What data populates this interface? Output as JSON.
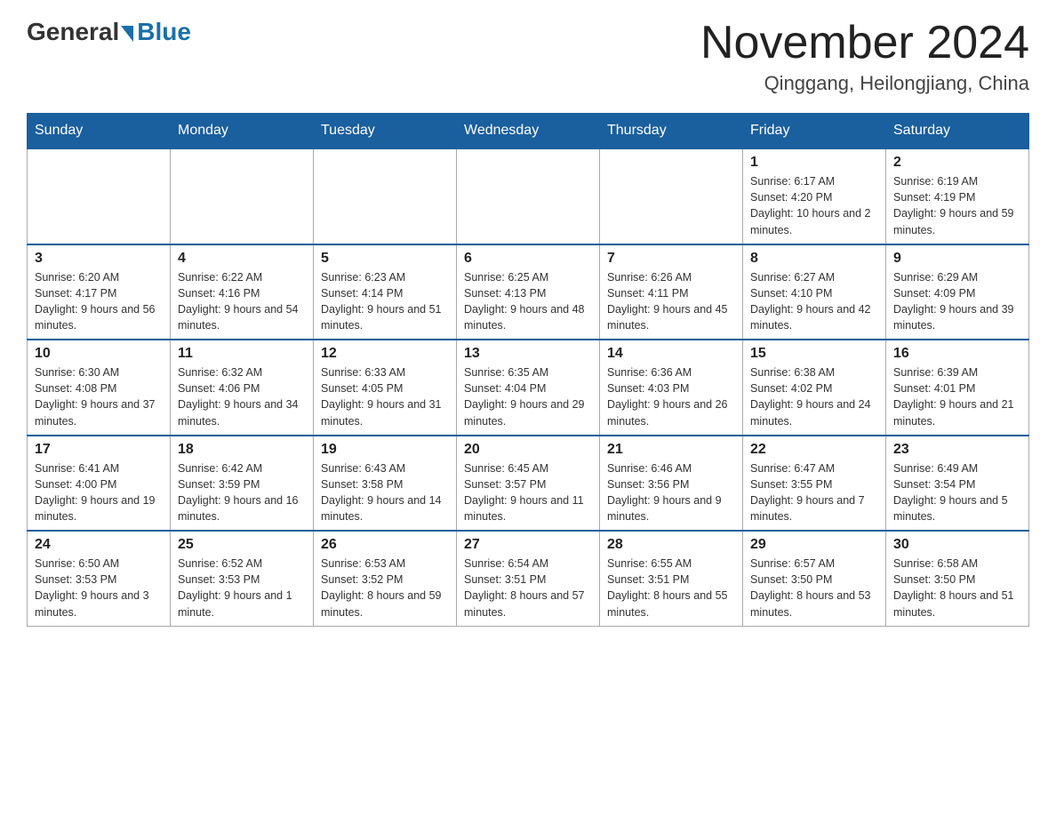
{
  "logo": {
    "general": "General",
    "blue": "Blue"
  },
  "title": "November 2024",
  "location": "Qinggang, Heilongjiang, China",
  "weekdays": [
    "Sunday",
    "Monday",
    "Tuesday",
    "Wednesday",
    "Thursday",
    "Friday",
    "Saturday"
  ],
  "weeks": [
    [
      {
        "day": "",
        "info": ""
      },
      {
        "day": "",
        "info": ""
      },
      {
        "day": "",
        "info": ""
      },
      {
        "day": "",
        "info": ""
      },
      {
        "day": "",
        "info": ""
      },
      {
        "day": "1",
        "info": "Sunrise: 6:17 AM\nSunset: 4:20 PM\nDaylight: 10 hours and 2 minutes."
      },
      {
        "day": "2",
        "info": "Sunrise: 6:19 AM\nSunset: 4:19 PM\nDaylight: 9 hours and 59 minutes."
      }
    ],
    [
      {
        "day": "3",
        "info": "Sunrise: 6:20 AM\nSunset: 4:17 PM\nDaylight: 9 hours and 56 minutes."
      },
      {
        "day": "4",
        "info": "Sunrise: 6:22 AM\nSunset: 4:16 PM\nDaylight: 9 hours and 54 minutes."
      },
      {
        "day": "5",
        "info": "Sunrise: 6:23 AM\nSunset: 4:14 PM\nDaylight: 9 hours and 51 minutes."
      },
      {
        "day": "6",
        "info": "Sunrise: 6:25 AM\nSunset: 4:13 PM\nDaylight: 9 hours and 48 minutes."
      },
      {
        "day": "7",
        "info": "Sunrise: 6:26 AM\nSunset: 4:11 PM\nDaylight: 9 hours and 45 minutes."
      },
      {
        "day": "8",
        "info": "Sunrise: 6:27 AM\nSunset: 4:10 PM\nDaylight: 9 hours and 42 minutes."
      },
      {
        "day": "9",
        "info": "Sunrise: 6:29 AM\nSunset: 4:09 PM\nDaylight: 9 hours and 39 minutes."
      }
    ],
    [
      {
        "day": "10",
        "info": "Sunrise: 6:30 AM\nSunset: 4:08 PM\nDaylight: 9 hours and 37 minutes."
      },
      {
        "day": "11",
        "info": "Sunrise: 6:32 AM\nSunset: 4:06 PM\nDaylight: 9 hours and 34 minutes."
      },
      {
        "day": "12",
        "info": "Sunrise: 6:33 AM\nSunset: 4:05 PM\nDaylight: 9 hours and 31 minutes."
      },
      {
        "day": "13",
        "info": "Sunrise: 6:35 AM\nSunset: 4:04 PM\nDaylight: 9 hours and 29 minutes."
      },
      {
        "day": "14",
        "info": "Sunrise: 6:36 AM\nSunset: 4:03 PM\nDaylight: 9 hours and 26 minutes."
      },
      {
        "day": "15",
        "info": "Sunrise: 6:38 AM\nSunset: 4:02 PM\nDaylight: 9 hours and 24 minutes."
      },
      {
        "day": "16",
        "info": "Sunrise: 6:39 AM\nSunset: 4:01 PM\nDaylight: 9 hours and 21 minutes."
      }
    ],
    [
      {
        "day": "17",
        "info": "Sunrise: 6:41 AM\nSunset: 4:00 PM\nDaylight: 9 hours and 19 minutes."
      },
      {
        "day": "18",
        "info": "Sunrise: 6:42 AM\nSunset: 3:59 PM\nDaylight: 9 hours and 16 minutes."
      },
      {
        "day": "19",
        "info": "Sunrise: 6:43 AM\nSunset: 3:58 PM\nDaylight: 9 hours and 14 minutes."
      },
      {
        "day": "20",
        "info": "Sunrise: 6:45 AM\nSunset: 3:57 PM\nDaylight: 9 hours and 11 minutes."
      },
      {
        "day": "21",
        "info": "Sunrise: 6:46 AM\nSunset: 3:56 PM\nDaylight: 9 hours and 9 minutes."
      },
      {
        "day": "22",
        "info": "Sunrise: 6:47 AM\nSunset: 3:55 PM\nDaylight: 9 hours and 7 minutes."
      },
      {
        "day": "23",
        "info": "Sunrise: 6:49 AM\nSunset: 3:54 PM\nDaylight: 9 hours and 5 minutes."
      }
    ],
    [
      {
        "day": "24",
        "info": "Sunrise: 6:50 AM\nSunset: 3:53 PM\nDaylight: 9 hours and 3 minutes."
      },
      {
        "day": "25",
        "info": "Sunrise: 6:52 AM\nSunset: 3:53 PM\nDaylight: 9 hours and 1 minute."
      },
      {
        "day": "26",
        "info": "Sunrise: 6:53 AM\nSunset: 3:52 PM\nDaylight: 8 hours and 59 minutes."
      },
      {
        "day": "27",
        "info": "Sunrise: 6:54 AM\nSunset: 3:51 PM\nDaylight: 8 hours and 57 minutes."
      },
      {
        "day": "28",
        "info": "Sunrise: 6:55 AM\nSunset: 3:51 PM\nDaylight: 8 hours and 55 minutes."
      },
      {
        "day": "29",
        "info": "Sunrise: 6:57 AM\nSunset: 3:50 PM\nDaylight: 8 hours and 53 minutes."
      },
      {
        "day": "30",
        "info": "Sunrise: 6:58 AM\nSunset: 3:50 PM\nDaylight: 8 hours and 51 minutes."
      }
    ]
  ]
}
